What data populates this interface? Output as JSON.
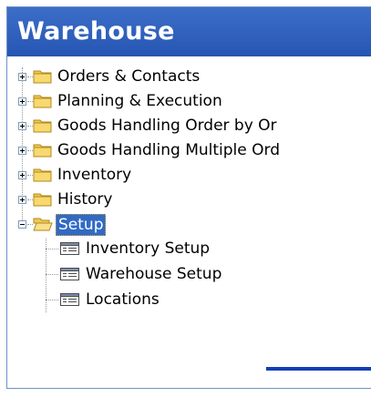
{
  "window": {
    "title": "Warehouse"
  },
  "tree": {
    "items": [
      {
        "label": "Orders & Contacts",
        "expanded": false,
        "icon": "folder-closed-icon"
      },
      {
        "label": "Planning & Execution",
        "expanded": false,
        "icon": "folder-closed-icon"
      },
      {
        "label": "Goods Handling Order by Or",
        "expanded": false,
        "icon": "folder-closed-icon"
      },
      {
        "label": "Goods Handling Multiple Ord",
        "expanded": false,
        "icon": "folder-closed-icon"
      },
      {
        "label": "Inventory",
        "expanded": false,
        "icon": "folder-closed-icon"
      },
      {
        "label": "History",
        "expanded": false,
        "icon": "folder-closed-icon"
      },
      {
        "label": "Setup",
        "expanded": true,
        "selected": true,
        "icon": "folder-open-icon",
        "children": [
          {
            "label": "Inventory Setup",
            "icon": "form-icon"
          },
          {
            "label": "Warehouse Setup",
            "icon": "form-icon"
          },
          {
            "label": "Locations",
            "icon": "form-icon"
          }
        ]
      }
    ]
  },
  "colors": {
    "titlebar": "#2f60bd",
    "selection": "#316ac5",
    "annotation_line": "#1040b8"
  }
}
